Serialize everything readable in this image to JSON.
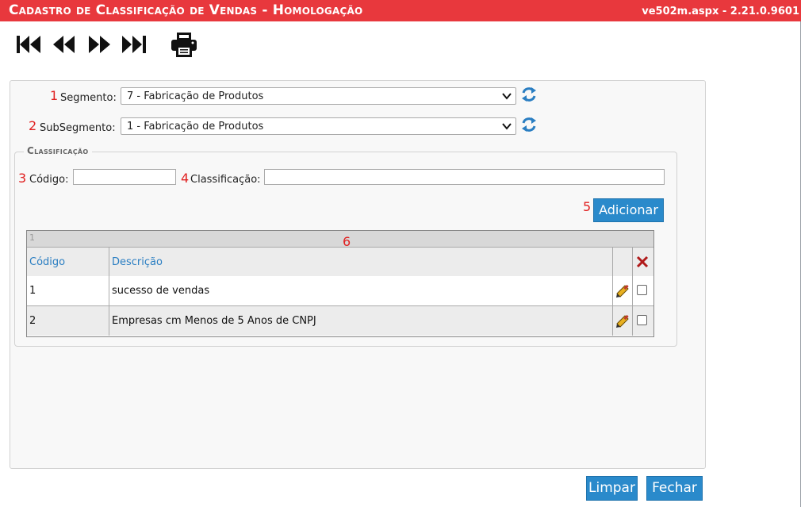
{
  "window": {
    "title": "Cadastro de Classificação de Vendas  - Homologação",
    "version": "ve502m.aspx - 2.21.0.9601"
  },
  "toolbar": {
    "icons": [
      "first-record-icon",
      "previous-record-icon",
      "next-record-icon",
      "last-record-icon",
      "print-icon"
    ]
  },
  "form": {
    "segmento": {
      "number": "1",
      "label": "Segmento:",
      "value": "7 - Fabricação de Produtos"
    },
    "subsegmento": {
      "number": "2",
      "label": "SubSegmento:",
      "value": "1 - Fabricação de Produtos"
    },
    "group_title": "Classificação",
    "codigo": {
      "number": "3",
      "label": "Código:",
      "value": ""
    },
    "classificacao": {
      "number": "4",
      "label": "Classificação:",
      "value": ""
    },
    "add_number": "5",
    "add_label": "Adicionar"
  },
  "grid": {
    "number": "6",
    "page": "1",
    "columns": [
      "Código",
      "Descrição"
    ],
    "rows": [
      {
        "codigo": "1",
        "descricao": "sucesso de vendas"
      },
      {
        "codigo": "2",
        "descricao": "Empresas cm Menos de 5 Anos de CNPJ"
      }
    ]
  },
  "footer": {
    "limpar_label": "Limpar",
    "fechar_label": "Fechar"
  },
  "colors": {
    "titlebar": "#e8383d",
    "button": "#2a8acb",
    "link": "#2a7ec2",
    "marker": "#e02020"
  }
}
